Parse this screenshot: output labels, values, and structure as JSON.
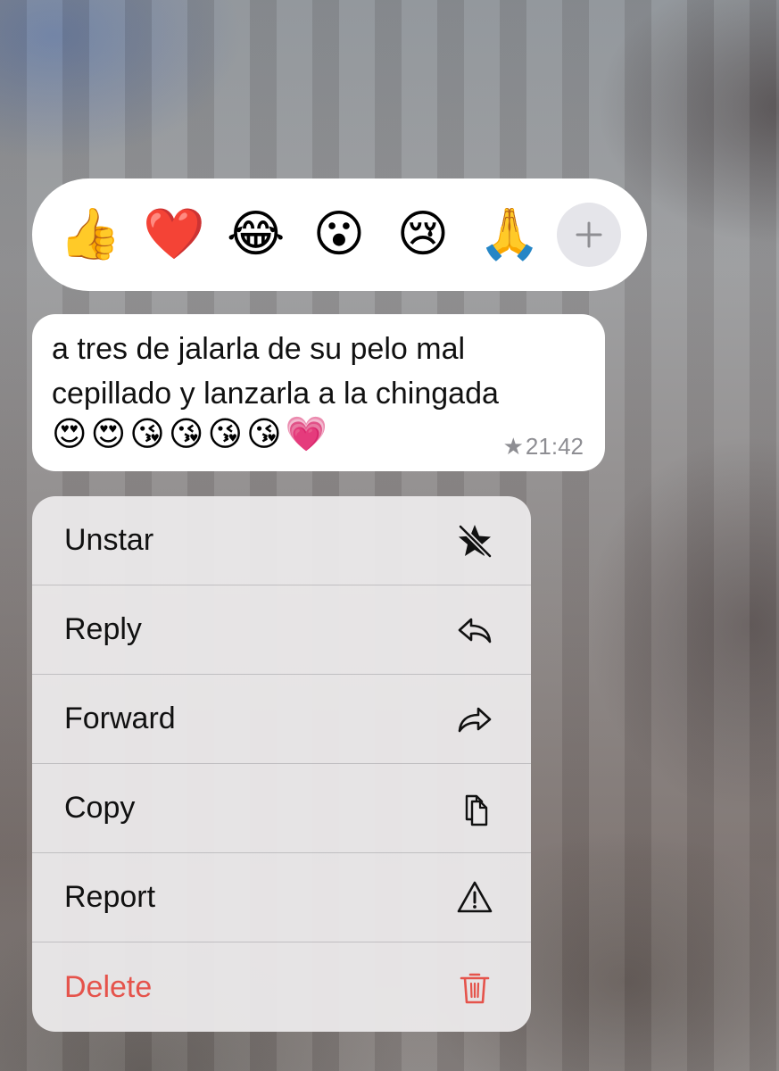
{
  "reactions": {
    "items": [
      {
        "name": "thumbs-up",
        "glyph": "👍"
      },
      {
        "name": "red-heart",
        "glyph": "❤️"
      },
      {
        "name": "tears-of-joy",
        "glyph": "😂"
      },
      {
        "name": "surprised-face",
        "glyph": "😮"
      },
      {
        "name": "crying-face",
        "glyph": "😢"
      },
      {
        "name": "folded-hands",
        "glyph": "🙏"
      }
    ],
    "more_icon": "plus-icon"
  },
  "message": {
    "line1": "a tres de jalarla de su pelo mal",
    "line2": "cepillado y lanzarla a la chingada",
    "emojis": "😍😍😘😘😘😘💗",
    "starred": true,
    "star_glyph": "★",
    "time": "21:42"
  },
  "menu": {
    "items": [
      {
        "label": "Unstar",
        "icon": "unstar-icon"
      },
      {
        "label": "Reply",
        "icon": "reply-icon"
      },
      {
        "label": "Forward",
        "icon": "forward-icon"
      },
      {
        "label": "Copy",
        "icon": "copy-icon"
      },
      {
        "label": "Report",
        "icon": "report-icon"
      },
      {
        "label": "Delete",
        "icon": "trash-icon",
        "destructive": true
      }
    ]
  },
  "colors": {
    "destructive": "#e5534b",
    "timestamp": "#8e8e93",
    "surface": "#ffffff",
    "menu_background": "#eae8e9"
  }
}
